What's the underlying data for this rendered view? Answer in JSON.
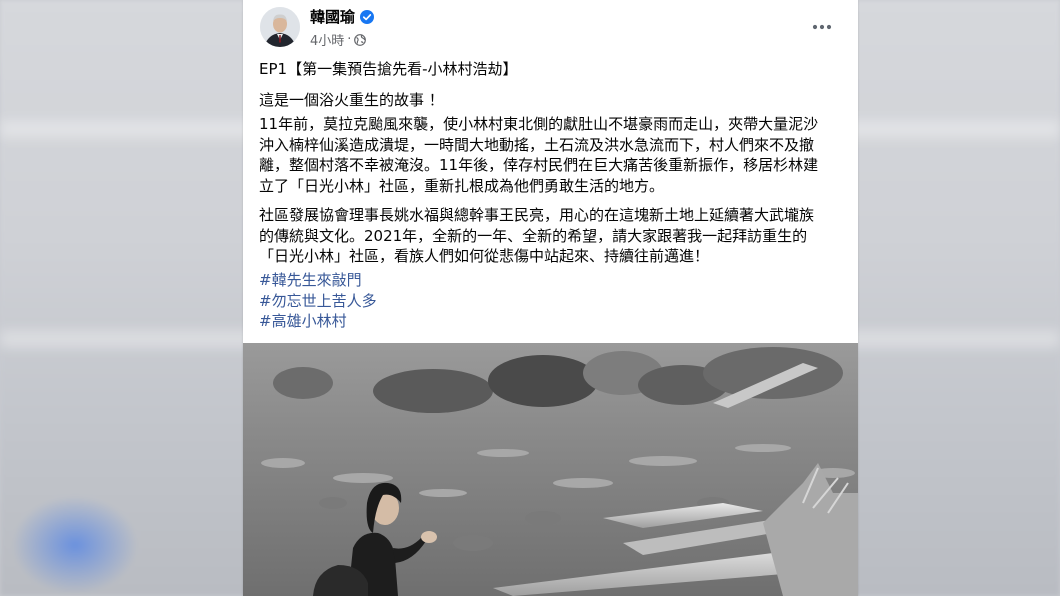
{
  "post": {
    "author": "韓國瑜",
    "timestamp": "4小時",
    "title_line": "EP1【第一集預告搶先看-小林村浩劫】",
    "intro": "這是一個浴火重生的故事 ！",
    "paragraph1": [
      "11年前，莫拉克颱風來襲，使小林村東北側的獻肚山不堪豪雨而走山，夾帶大量泥沙",
      "沖入楠梓仙溪造成潰堤，一時間大地動搖，土石流及洪水急流而下，村人們來不及撤",
      "離，整個村落不幸被淹沒。11年後，倖存村民們在巨大痛苦後重新振作，移居杉林建",
      "立了「日光小林」社區，重新扎根成為他們勇敢生活的地方。"
    ],
    "paragraph2": [
      "社區發展協會理事長姚水福與總幹事王民亮，用心的在這塊新土地上延續著大武壠族",
      "的傳統與文化。2021年，全新的一年、全新的希望，請大家跟著我一起拜訪重生的",
      "「日光小林」社區，看族人們如何從悲傷中站起來、持續往前邁進！"
    ],
    "hashtags": [
      "#韓先生來敲門",
      "#勿忘世上苦人多",
      "#高雄小林村"
    ]
  },
  "icons": {
    "verified": "verified-badge-icon",
    "privacy": "globe-icon",
    "more": "more-options-icon"
  },
  "colors": {
    "hashtag": "#385898",
    "verified": "#1877f2",
    "meta_text": "#65676b"
  }
}
